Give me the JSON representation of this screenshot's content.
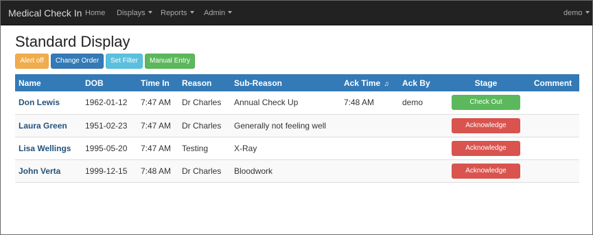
{
  "navbar": {
    "brand": "Medical Check In",
    "items": [
      {
        "label": "Home",
        "dropdown": false
      },
      {
        "label": "Displays",
        "dropdown": true
      },
      {
        "label": "Reports",
        "dropdown": true
      },
      {
        "label": "Admin",
        "dropdown": true
      }
    ],
    "user": {
      "label": "demo",
      "dropdown": true
    }
  },
  "page": {
    "title": "Standard Display"
  },
  "toolbar": {
    "alert_off": "Alert off",
    "change_order": "Change Order",
    "set_filter": "Set Filter",
    "manual_entry": "Manual Entry"
  },
  "table": {
    "headers": {
      "name": "Name",
      "dob": "DOB",
      "time_in": "Time In",
      "reason": "Reason",
      "sub_reason": "Sub-Reason",
      "ack_time": "Ack Time",
      "ack_time_icon": "♫",
      "ack_by": "Ack By",
      "stage": "Stage",
      "comment": "Comment"
    },
    "rows": [
      {
        "name": "Don Lewis",
        "dob": "1962-01-12",
        "time_in": "7:47 AM",
        "reason": "Dr Charles",
        "sub_reason": "Annual Check Up",
        "ack_time": "7:48 AM",
        "ack_by": "demo",
        "stage": "Check Out",
        "stage_type": "success",
        "comment": ""
      },
      {
        "name": "Laura Green",
        "dob": "1951-02-23",
        "time_in": "7:47 AM",
        "reason": "Dr Charles",
        "sub_reason": "Generally not feeling well",
        "ack_time": "",
        "ack_by": "",
        "stage": "Acknowledge",
        "stage_type": "danger",
        "comment": ""
      },
      {
        "name": "Lisa Wellings",
        "dob": "1995-05-20",
        "time_in": "7:47 AM",
        "reason": "Testing",
        "sub_reason": "X-Ray",
        "ack_time": "",
        "ack_by": "",
        "stage": "Acknowledge",
        "stage_type": "danger",
        "comment": ""
      },
      {
        "name": "John Verta",
        "dob": "1999-12-15",
        "time_in": "7:48 AM",
        "reason": "Dr Charles",
        "sub_reason": "Bloodwork",
        "ack_time": "",
        "ack_by": "",
        "stage": "Acknowledge",
        "stage_type": "danger",
        "comment": ""
      }
    ]
  },
  "colors": {
    "navbar_bg": "#222222",
    "table_header_bg": "#337ab7",
    "link": "#23527c",
    "success": "#5cb85c",
    "danger": "#d9534f",
    "warning": "#f0ad4e",
    "info": "#5bc0de"
  }
}
